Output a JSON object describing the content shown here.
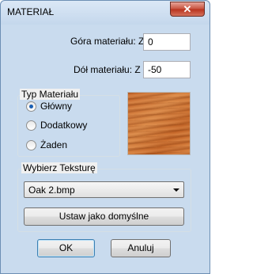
{
  "window": {
    "title": "MATERIAŁ",
    "close_glyph": "✕"
  },
  "fields": {
    "top_label": "Góra materiału: Z",
    "top_value": "0",
    "bottom_label": "Dół materiału: Z",
    "bottom_value": "-50"
  },
  "material_type": {
    "caption": "Typ Materiału",
    "options": [
      {
        "label": "Główny",
        "checked": true
      },
      {
        "label": "Dodatkowy",
        "checked": false
      },
      {
        "label": "Żaden",
        "checked": false
      }
    ]
  },
  "texture": {
    "caption": "Wybierz Teksturę",
    "selected": "Oak 2.bmp",
    "set_default_label": "Ustaw jako domyślne"
  },
  "buttons": {
    "ok": "OK",
    "cancel": "Anuluj"
  }
}
